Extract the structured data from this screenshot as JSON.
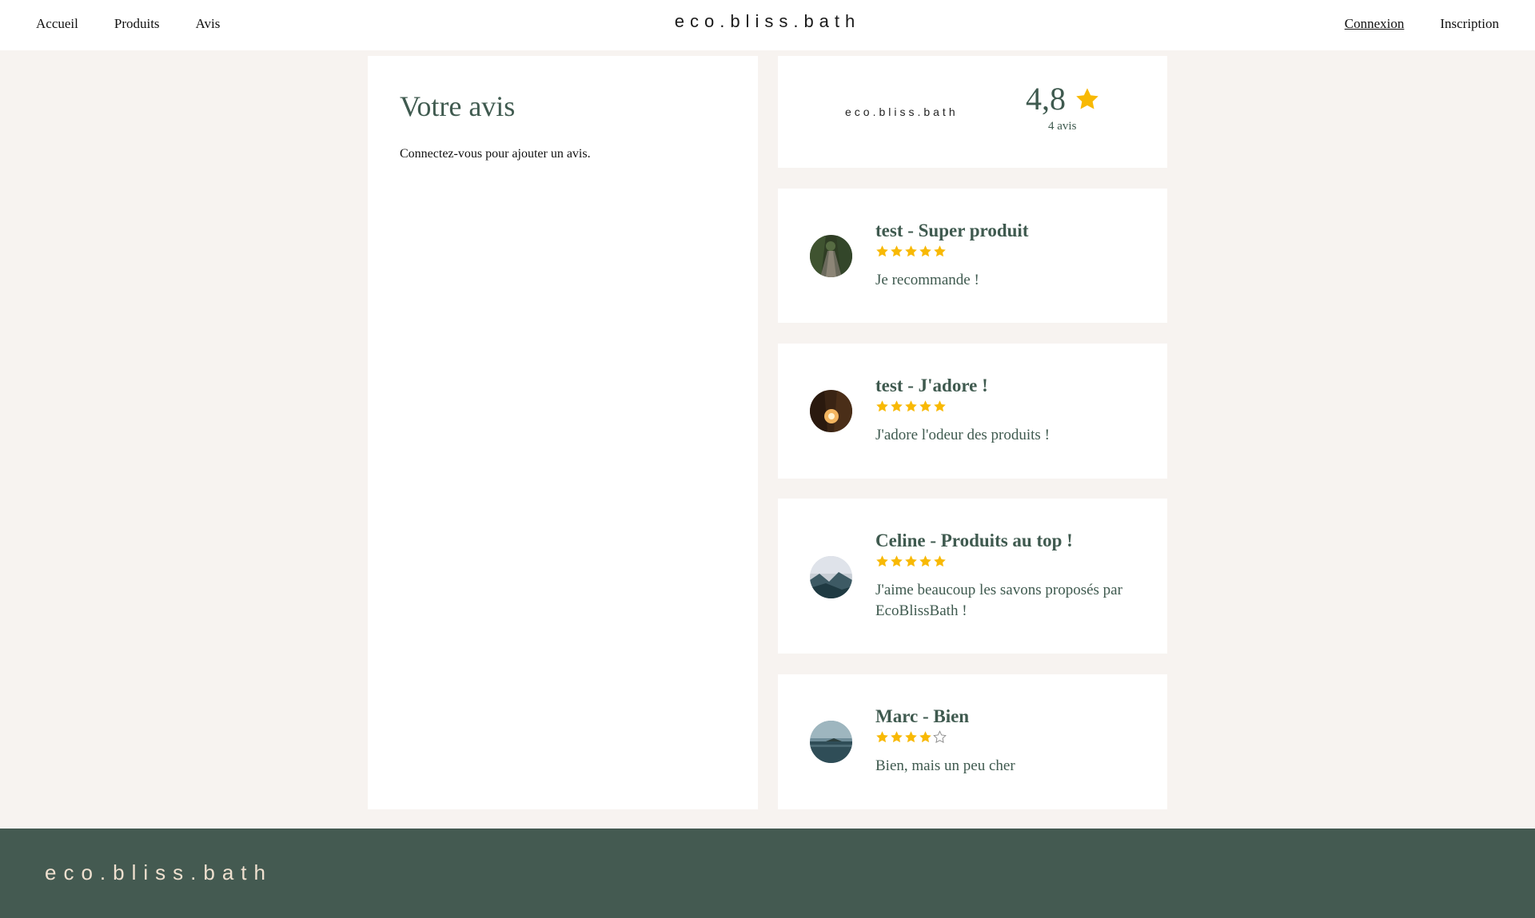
{
  "nav": {
    "left": [
      "Accueil",
      "Produits",
      "Avis"
    ],
    "brand": "eco.bliss.bath",
    "login": "Connexion",
    "signup": "Inscription"
  },
  "form": {
    "title": "Votre avis",
    "message": "Connectez-vous pour ajouter un avis."
  },
  "summary": {
    "brand": "eco.bliss.bath",
    "score": "4,8",
    "count": "4 avis",
    "star_color": "#f8b904"
  },
  "reviews": [
    {
      "title": "test - Super produit",
      "rating": 5,
      "text": "Je recommande !",
      "avatar": "forest-bridge-photo"
    },
    {
      "title": "test - J'adore !",
      "rating": 5,
      "text": "J'adore l'odeur des produits !",
      "avatar": "sunset-canyon-photo"
    },
    {
      "title": "Celine - Produits au top !",
      "rating": 5,
      "text": "J'aime beaucoup les savons proposés par EcoBlissBath !",
      "avatar": "misty-mountain-photo"
    },
    {
      "title": "Marc - Bien",
      "rating": 4,
      "text": "Bien, mais un peu cher",
      "avatar": "lake-island-photo"
    }
  ],
  "footer": {
    "brand": "eco.bliss.bath"
  },
  "colors": {
    "accent": "#445a51",
    "star": "#f8b904",
    "background": "#f7f3f0"
  }
}
